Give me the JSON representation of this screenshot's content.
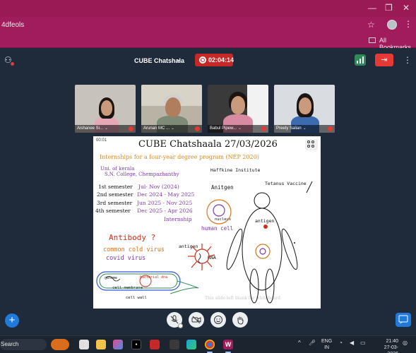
{
  "browser": {
    "url_fragment": "4dfeols",
    "bookmarks_label": "All Bookmarks"
  },
  "meeting": {
    "title": "CUBE Chatshala",
    "recording_time": "02:04:14"
  },
  "participants": [
    {
      "name": "Aishanee Si...",
      "shirt": "#e6a7b6"
    },
    {
      "name": "Arunan MC ...",
      "shirt": "#7d8a76"
    },
    {
      "name": "Babul Pipew...",
      "shirt": "#d98aa3"
    },
    {
      "name": "Preety Salian",
      "shirt": "#3d6bb0"
    }
  ],
  "slide": {
    "timer": "00:01",
    "title": "CUBE Chatshaala 27/03/2026",
    "subtitle": "Internships for a four-year degree program (NEP 2020)",
    "institution_line1": "Uni. of kerala",
    "institution_line2": "S.N. College, Chempazhanthy",
    "semesters": [
      {
        "label": "1st semester",
        "dates": "Jul- Nov (2024)"
      },
      {
        "label": "2nd semester",
        "dates": "Dec 2024 - May 2025"
      },
      {
        "label": "3rd semester",
        "dates": "Jun 2025 - Nov 2025"
      },
      {
        "label": "4th semester",
        "dates": "Dec 2025 - Apr 2026"
      }
    ],
    "internship": "Internship",
    "haffkine": "Haffkine  Institute",
    "tetanus": "Tetanus Vaccine",
    "antigen_heading": "Anitgen",
    "nucleus": "nucleus",
    "human_cell": "human cell",
    "antigen_label_body": "antigen",
    "antibody": "Antibody ?",
    "common_cold": "common cold virus",
    "covid": "covid virus",
    "antigen_label_virus": "antigen",
    "rna": "RNA",
    "genome": "genome",
    "bacterial_dna": "bacterial dna",
    "cell_membrane": "cell membrane",
    "cell_wall": "cell wall",
    "ghost_text": "This slide left blank for whiteboard"
  },
  "taskbar": {
    "search": "Search",
    "lang_line1": "ENG",
    "lang_line2": "IN",
    "time": "21:40",
    "date": "27-03-2026"
  },
  "colors": {
    "chrome": "#a11c5c",
    "meeting_bg": "#1f2b3a",
    "record": "#c62828",
    "accent_blue": "#1f7ad9"
  }
}
